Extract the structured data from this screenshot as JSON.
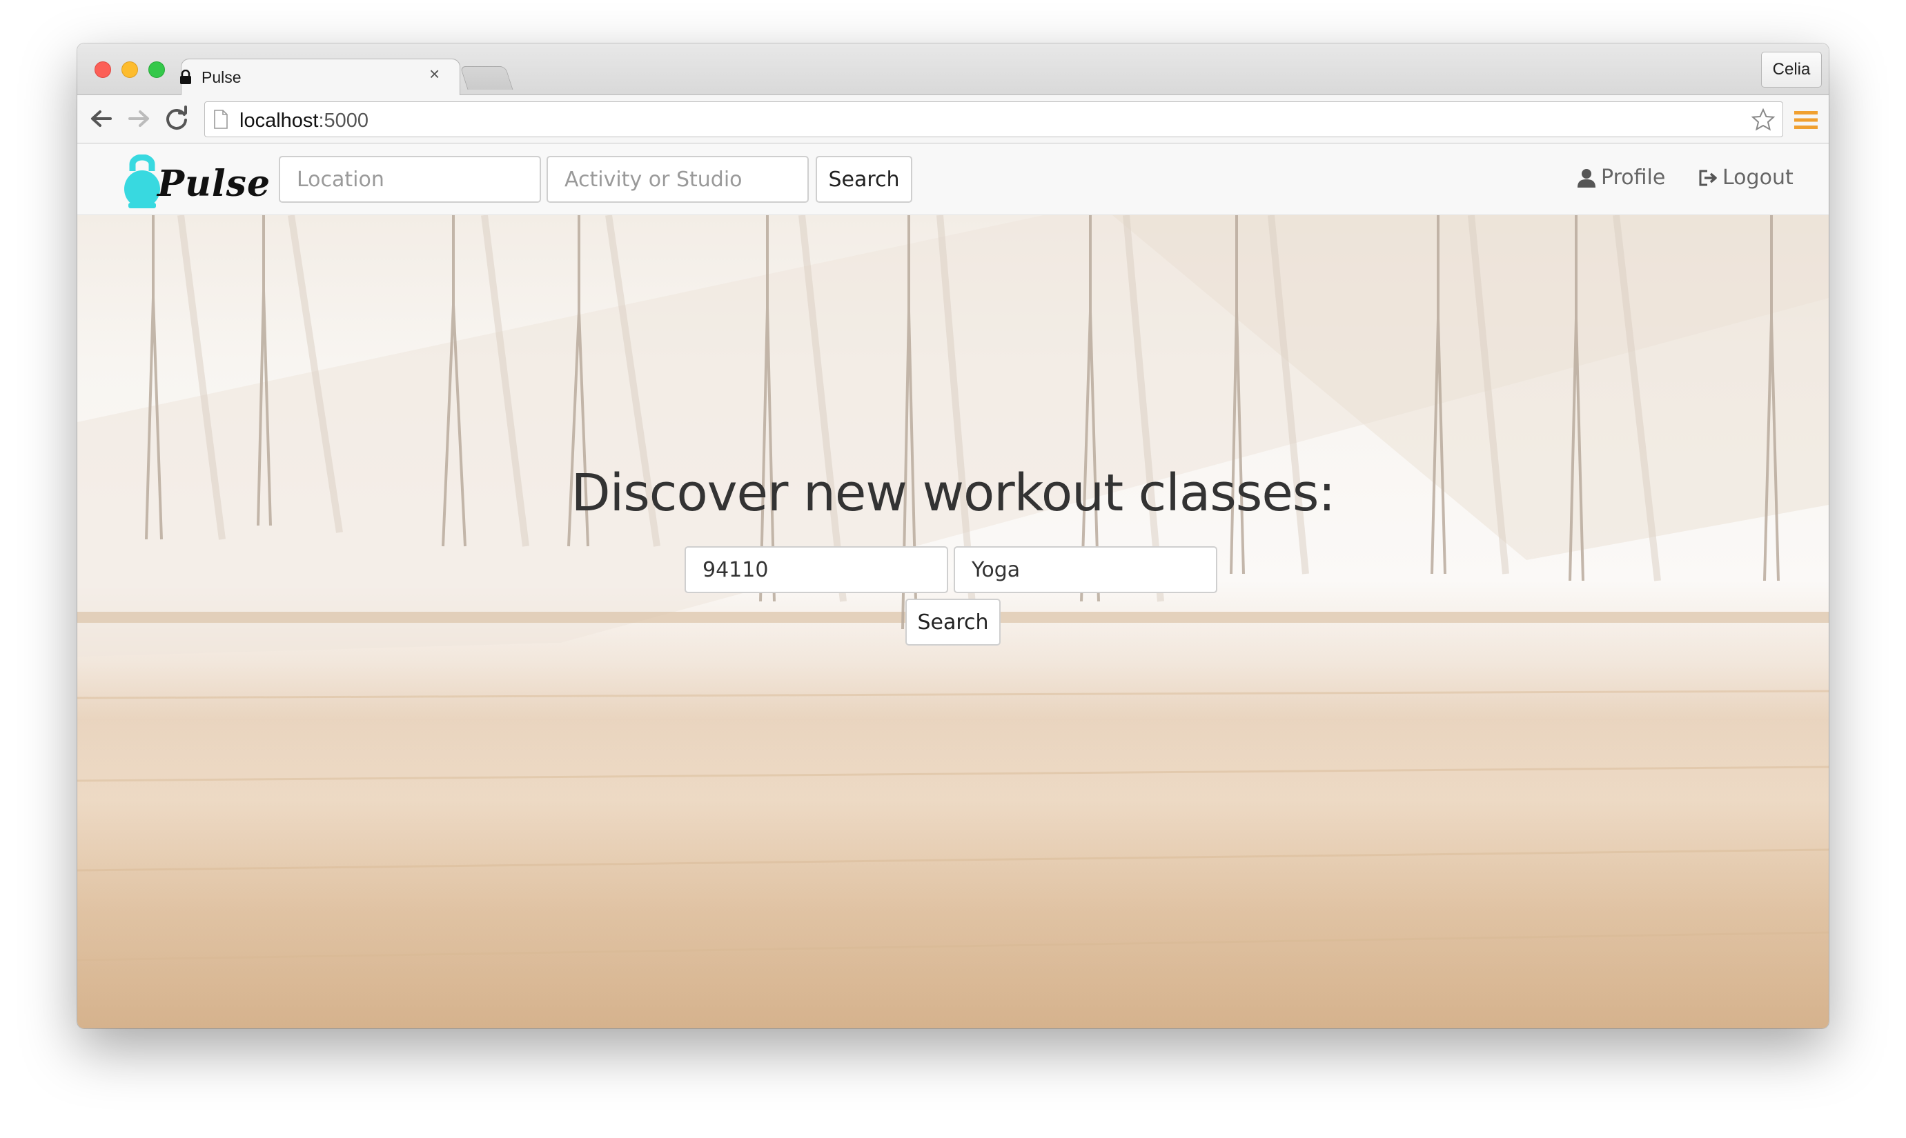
{
  "browser": {
    "tab_title": "Pulse",
    "tab_close": "×",
    "profile_name": "Celia",
    "url_host": "localhost",
    "url_port": ":5000",
    "icons": [
      "lock-icon",
      "back-arrow-icon",
      "forward-arrow-icon",
      "reload-icon",
      "page-icon",
      "star-icon",
      "menu-icon"
    ],
    "menu_color": "#f0a030"
  },
  "navbar": {
    "brand": "Pulse",
    "brand_color": "#38d9e0",
    "location_placeholder": "Location",
    "activity_placeholder": "Activity or Studio",
    "search_label": "Search",
    "profile_label": "Profile",
    "logout_label": "Logout"
  },
  "hero": {
    "title": "Discover new workout classes:",
    "location_value": "94110",
    "activity_value": "Yoga",
    "search_label": "Search"
  }
}
